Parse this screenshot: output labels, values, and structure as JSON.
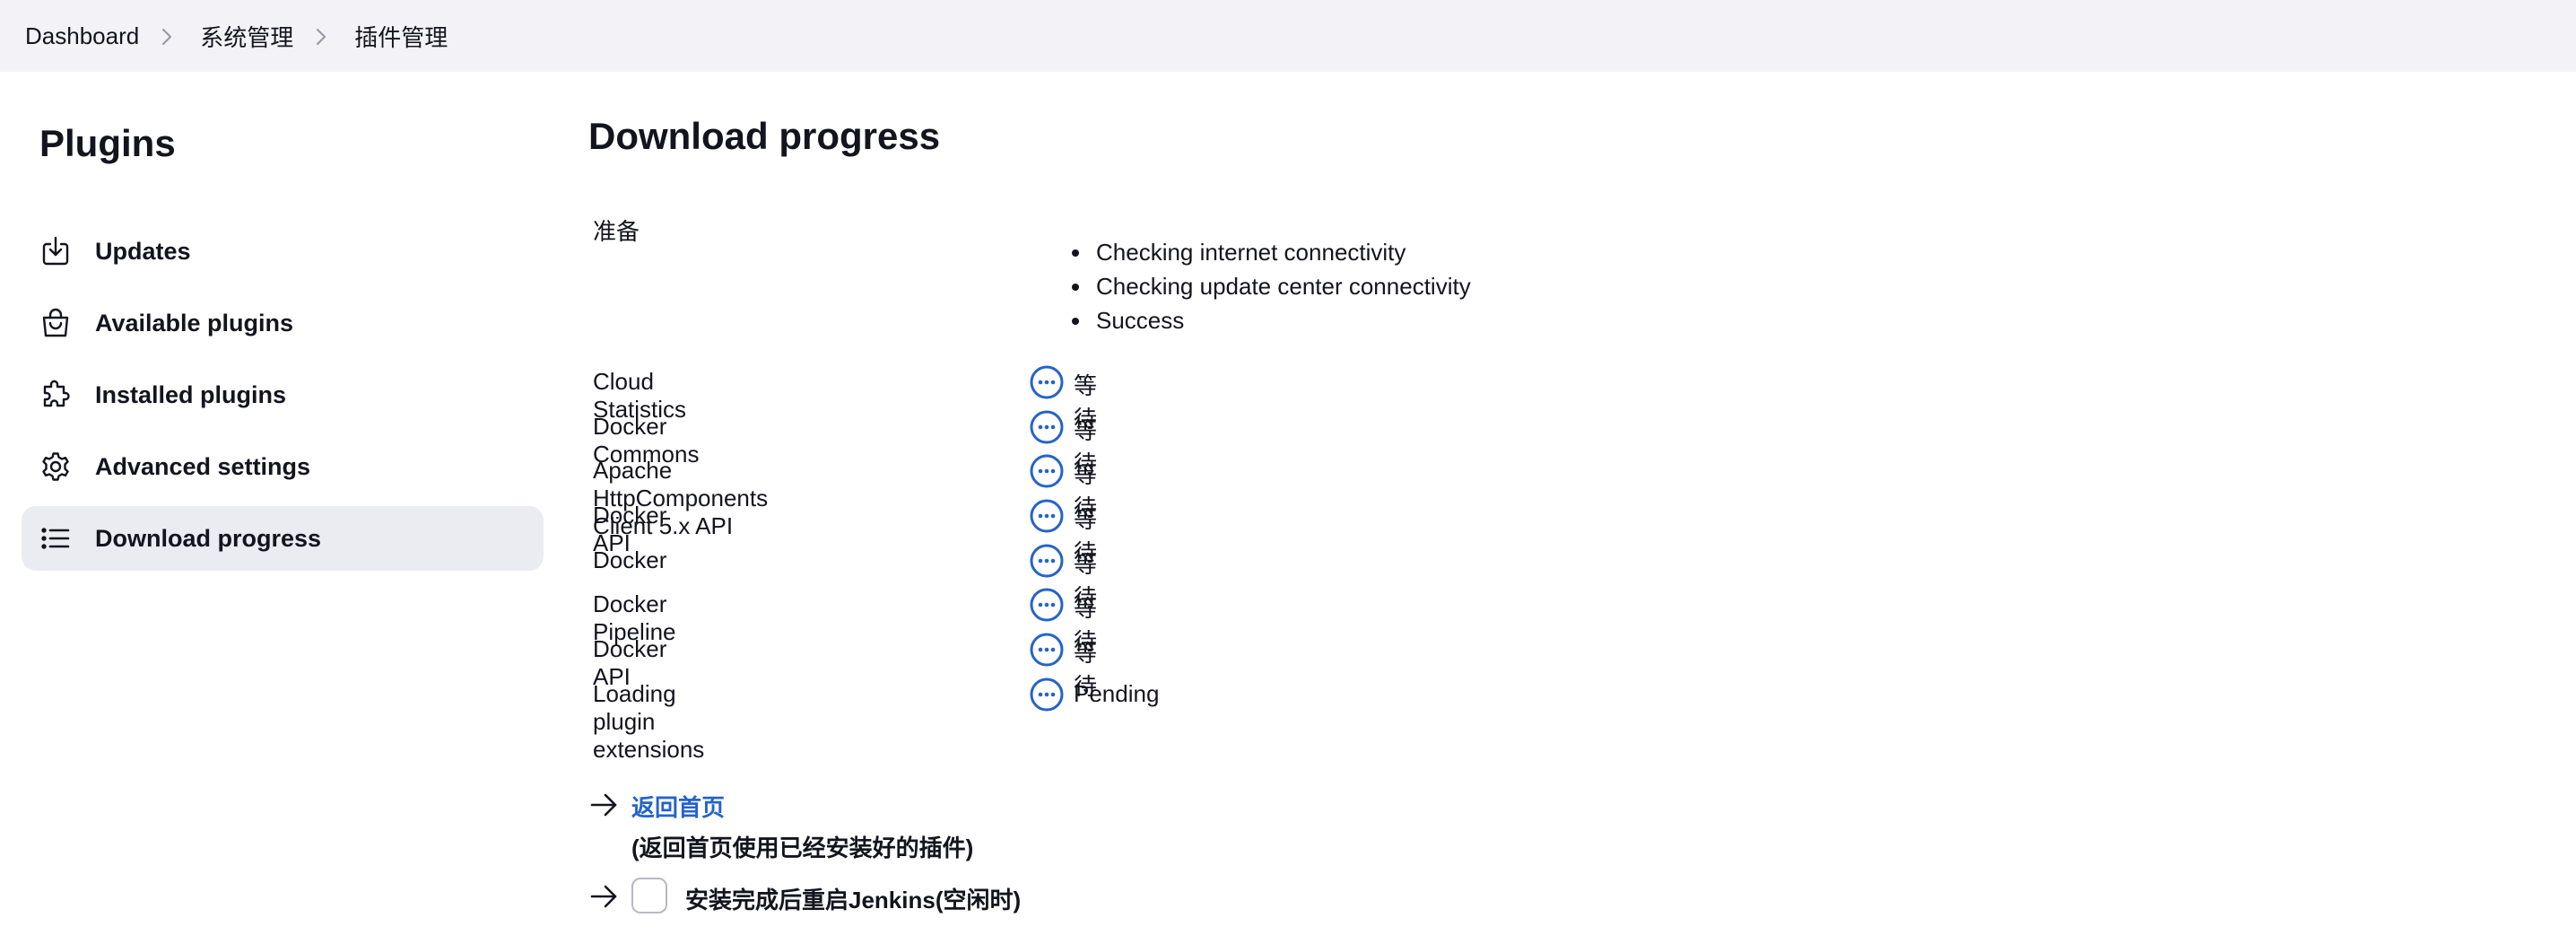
{
  "breadcrumb": {
    "items": [
      "Dashboard",
      "系统管理",
      "插件管理"
    ]
  },
  "sidebar": {
    "title": "Plugins",
    "items": [
      {
        "label": "Updates",
        "icon": "download-icon"
      },
      {
        "label": "Available plugins",
        "icon": "shopping-bag-icon"
      },
      {
        "label": "Installed plugins",
        "icon": "puzzle-icon"
      },
      {
        "label": "Advanced settings",
        "icon": "gear-icon"
      },
      {
        "label": "Download progress",
        "icon": "list-icon",
        "active": true
      }
    ]
  },
  "main": {
    "title": "Download progress",
    "preparation": {
      "label": "准备",
      "steps": [
        "Checking internet connectivity",
        "Checking update center connectivity",
        "Success"
      ]
    },
    "jobs": [
      {
        "name": "Cloud Statistics",
        "status": "等待",
        "icon": "ellipsis-circle-icon"
      },
      {
        "name": "Docker Commons",
        "status": "等待",
        "icon": "ellipsis-circle-icon"
      },
      {
        "name": "Apache HttpComponents Client 5.x API",
        "status": "等待",
        "icon": "ellipsis-circle-icon"
      },
      {
        "name": "Docker API",
        "status": "等待",
        "icon": "ellipsis-circle-icon"
      },
      {
        "name": "Docker",
        "status": "等待",
        "icon": "ellipsis-circle-icon"
      },
      {
        "name": "Docker Pipeline",
        "status": "等待",
        "icon": "ellipsis-circle-icon"
      },
      {
        "name": "Docker API",
        "status": "等待",
        "icon": "ellipsis-circle-icon"
      },
      {
        "name": "Loading plugin extensions",
        "status": "Pending",
        "icon": "ellipsis-circle-icon"
      }
    ],
    "go_home": {
      "link_label": "返回首页",
      "description": "(返回首页使用已经安装好的插件)"
    },
    "restart": {
      "label": "安装完成后重启Jenkins(空闲时)",
      "checked": false
    }
  },
  "colors": {
    "accent": "#2563c9",
    "breadcrumb_bg": "#f3f3f7",
    "active_nav_bg": "#ebebf2"
  }
}
